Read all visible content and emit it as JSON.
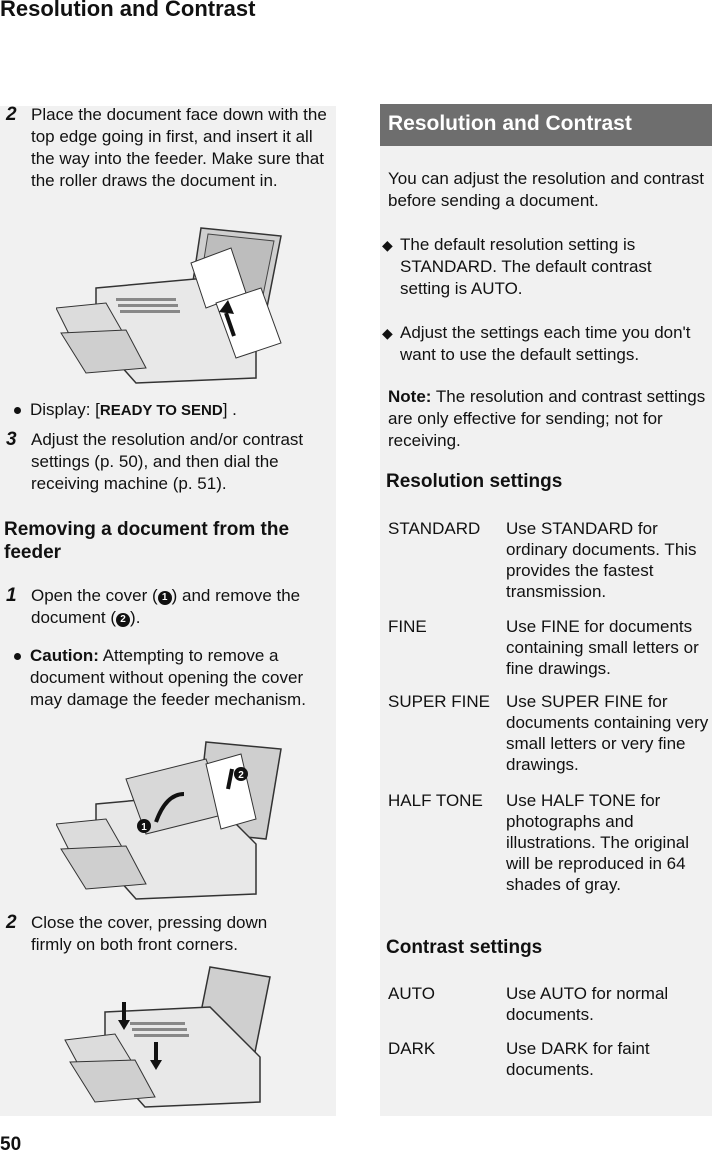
{
  "page": {
    "title": "Resolution and Contrast",
    "number": "50"
  },
  "left": {
    "step2_place": {
      "num": "2",
      "text": "Place the document face down with the top edge going in first, and insert it all the way into the feeder. Make sure that the roller draws the document in."
    },
    "display_bullet": {
      "prefix": "Display: [",
      "bold": "READY TO SEND",
      "suffix": "] ."
    },
    "step3": {
      "num": "3",
      "text": "Adjust the resolution and/or contrast settings (p. 50), and then dial the receiving machine (p. 51)."
    },
    "removing_heading": "Removing a document from the feeder",
    "step1_open": {
      "num": "1",
      "text_a": "Open the cover (",
      "marker1": "1",
      "text_b": ") and remove the document (",
      "marker2": "2",
      "text_c": ")."
    },
    "caution_bullet": {
      "bold": "Caution:",
      "text": " Attempting to remove a document without opening the cover may damage the feeder mechanism."
    },
    "step2_close": {
      "num": "2",
      "text": "Close the cover, pressing down firmly on both front corners."
    },
    "illustrations": [
      "fax-insert-document-illustration",
      "fax-open-cover-illustration",
      "fax-close-cover-illustration"
    ]
  },
  "right": {
    "banner": "Resolution and Contrast",
    "intro": "You can adjust the resolution and contrast before sending a document.",
    "bullets": [
      "The default resolution setting is STANDARD. The default contrast setting is AUTO.",
      "Adjust the settings each time you don't want to use the default settings."
    ],
    "note": {
      "label": "Note:",
      "text": " The resolution and contrast settings are only effective for sending; not for receiving."
    },
    "resolution_heading": "Resolution settings",
    "resolution_settings": [
      {
        "term": "STANDARD",
        "desc": "Use STANDARD for ordinary documents. This provides the fastest transmission."
      },
      {
        "term": "FINE",
        "desc": "Use FINE for documents containing small letters or fine drawings."
      },
      {
        "term": "SUPER FINE",
        "desc": "Use SUPER FINE for documents containing very small letters or very fine drawings."
      },
      {
        "term": "HALF TONE",
        "desc": "Use HALF TONE for photographs and illustrations. The original will be reproduced in 64 shades of gray."
      }
    ],
    "contrast_heading": "Contrast settings",
    "contrast_settings": [
      {
        "term": "AUTO",
        "desc": "Use AUTO for normal documents."
      },
      {
        "term": "DARK",
        "desc": "Use DARK for faint documents."
      }
    ]
  }
}
